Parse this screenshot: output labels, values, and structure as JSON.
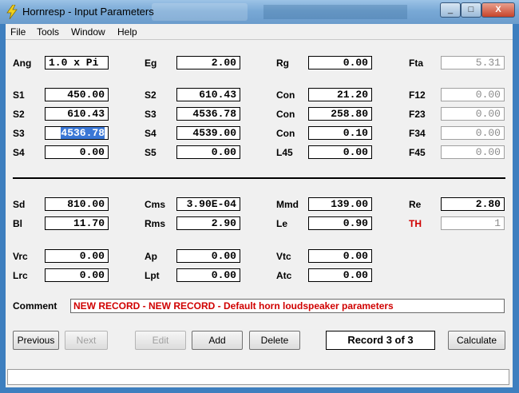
{
  "window": {
    "title": "Hornresp - Input Parameters",
    "min_label": "_",
    "max_label": "□",
    "close_label": "X"
  },
  "menu": [
    "File",
    "Tools",
    "Window",
    "Help"
  ],
  "fields": {
    "ang": {
      "label": "Ang",
      "value": "1.0 x Pi"
    },
    "eg": {
      "label": "Eg",
      "value": "2.00"
    },
    "rg": {
      "label": "Rg",
      "value": "0.00"
    },
    "fta": {
      "label": "Fta",
      "value": "5.31"
    },
    "s1": {
      "label": "S1",
      "value": "450.00"
    },
    "s2a": {
      "label": "S2",
      "value": "610.43"
    },
    "con1": {
      "label": "Con",
      "value": "21.20"
    },
    "f12": {
      "label": "F12",
      "value": "0.00"
    },
    "s2b": {
      "label": "S2",
      "value": "610.43"
    },
    "s3a": {
      "label": "S3",
      "value": "4536.78"
    },
    "con2": {
      "label": "Con",
      "value": "258.80"
    },
    "f23": {
      "label": "F23",
      "value": "0.00"
    },
    "s3b": {
      "label": "S3",
      "value": "4536.78"
    },
    "s4a": {
      "label": "S4",
      "value": "4539.00"
    },
    "con3": {
      "label": "Con",
      "value": "0.10"
    },
    "f34": {
      "label": "F34",
      "value": "0.00"
    },
    "s4b": {
      "label": "S4",
      "value": "0.00"
    },
    "s5": {
      "label": "S5",
      "value": "0.00"
    },
    "l45": {
      "label": "L45",
      "value": "0.00"
    },
    "f45": {
      "label": "F45",
      "value": "0.00"
    },
    "sd": {
      "label": "Sd",
      "value": "810.00"
    },
    "cms": {
      "label": "Cms",
      "value": "3.90E-04"
    },
    "mmd": {
      "label": "Mmd",
      "value": "139.00"
    },
    "re": {
      "label": "Re",
      "value": "2.80"
    },
    "bl": {
      "label": "Bl",
      "value": "11.70"
    },
    "rms": {
      "label": "Rms",
      "value": "2.90"
    },
    "le": {
      "label": "Le",
      "value": "0.90"
    },
    "th": {
      "label": "TH",
      "value": "1"
    },
    "vrc": {
      "label": "Vrc",
      "value": "0.00"
    },
    "ap": {
      "label": "Ap",
      "value": "0.00"
    },
    "vtc": {
      "label": "Vtc",
      "value": "0.00"
    },
    "lrc": {
      "label": "Lrc",
      "value": "0.00"
    },
    "lpt": {
      "label": "Lpt",
      "value": "0.00"
    },
    "atc": {
      "label": "Atc",
      "value": "0.00"
    }
  },
  "comment": {
    "label": "Comment",
    "value": "NEW RECORD - NEW RECORD - Default horn loudspeaker parameters"
  },
  "buttons": {
    "previous": "Previous",
    "next": "Next",
    "edit": "Edit",
    "add": "Add",
    "delete": "Delete",
    "calculate": "Calculate"
  },
  "record": "Record 3 of 3",
  "colors": {
    "accent_red": "#d00000",
    "selection": "#3a77d6"
  }
}
